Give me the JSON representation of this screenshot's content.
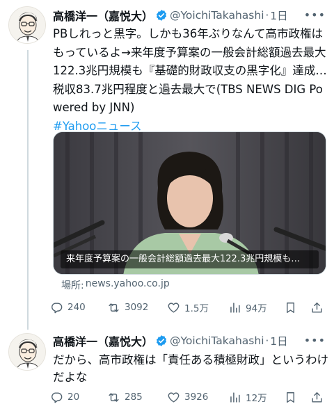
{
  "tweets": [
    {
      "name": "高橋洋一（嘉悦大）",
      "handle": "@YoichiTakahashi",
      "dot": "·",
      "time": "1日",
      "text": "PBしれっと黒字。しかも36年ぶりなんて高市政権はもっているよ→来年度予算案の一般会計総額過去最大122.3兆円規模も『基礎的財政収支の黒字化』達成…税収83.7兆円程度と過去最大で(TBS NEWS DIG Powered by JNN)",
      "hashtag": "#Yahooニュース",
      "media_caption": "来年度予算案の一般会計総額過去最大122.3兆円規模も…",
      "source_label": "場所:",
      "source_domain": "news.yahoo.co.jp",
      "stats": {
        "replies": "240",
        "reposts": "3092",
        "likes": "1.5万",
        "views": "94万"
      }
    },
    {
      "name": "高橋洋一（嘉悦大）",
      "handle": "@YoichiTakahashi",
      "dot": "·",
      "time": "1日",
      "text": "だから、高市政権は「責任ある積極財政」というわけだよな",
      "stats": {
        "replies": "20",
        "reposts": "285",
        "likes": "3926",
        "views": "12万"
      }
    }
  ],
  "icons": {
    "verified": "verified-badge-icon",
    "more": "more-icon",
    "reply": "reply-icon",
    "repost": "repost-icon",
    "like": "heart-icon",
    "views": "views-icon",
    "bookmark": "bookmark-icon",
    "share": "share-icon"
  },
  "colors": {
    "verified": "#1d9bf0",
    "hashtag": "#1d9bf0",
    "secondary": "#536471",
    "thread": "#cfd9de"
  }
}
